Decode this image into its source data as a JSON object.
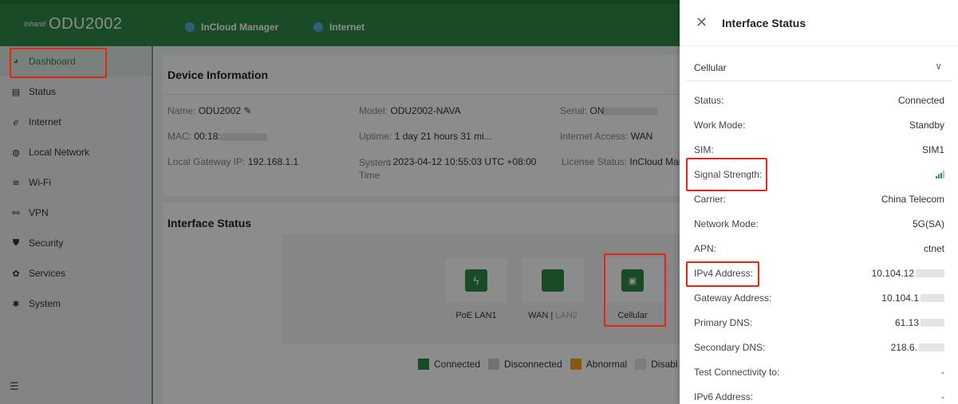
{
  "header": {
    "brand": "inhand",
    "device": "ODU2002",
    "incloud_label": "InCloud Manager",
    "internet_label": "Internet"
  },
  "sidebar": {
    "items": [
      {
        "label": "Dashboard",
        "icon": "dashboard-icon"
      },
      {
        "label": "Status",
        "icon": "status-icon"
      },
      {
        "label": "Internet",
        "icon": "internet-icon"
      },
      {
        "label": "Local Network",
        "icon": "local-network-icon"
      },
      {
        "label": "Wi-Fi",
        "icon": "wifi-icon"
      },
      {
        "label": "VPN",
        "icon": "vpn-icon"
      },
      {
        "label": "Security",
        "icon": "security-icon"
      },
      {
        "label": "Services",
        "icon": "services-icon"
      },
      {
        "label": "System",
        "icon": "system-icon"
      }
    ]
  },
  "device_info": {
    "title": "Device Information",
    "name_label": "Name:",
    "name_value": "ODU2002",
    "model_label": "Model:",
    "model_value": "ODU2002-NAVA",
    "serial_label": "Serial:",
    "serial_value": "ON",
    "mac_label": "MAC:",
    "mac_value": "00:18:",
    "uptime_label": "Uptime:",
    "uptime_value": "1 day 21 hours 31 mi...",
    "internet_access_label": "Internet Access:",
    "internet_access_value": "WAN",
    "gateway_label": "Local Gateway IP:",
    "gateway_value": "192.168.1.1",
    "system_time_label": "System Time",
    "system_time_value": ": 2023-04-12 10:55:03 UTC +08:00",
    "license_label": "License Status:",
    "license_value": "InCloud Man"
  },
  "interface_status": {
    "title": "Interface Status",
    "ports": [
      {
        "label": "PoE LAN1"
      },
      {
        "label": "WAN",
        "sub": "LAN2"
      },
      {
        "label": "Cellular"
      }
    ],
    "legend": {
      "connected": "Connected",
      "disconnected": "Disconnected",
      "abnormal": "Abnormal",
      "disabled": "Disabl"
    }
  },
  "panel": {
    "title": "Interface Status",
    "selected_interface": "Cellular",
    "rows": [
      {
        "key": "Status:",
        "value": "Connected"
      },
      {
        "key": "Work Mode:",
        "value": "Standby"
      },
      {
        "key": "SIM:",
        "value": "SIM1"
      },
      {
        "key": "Signal Strength:",
        "value": ""
      },
      {
        "key": "Carrier:",
        "value": "China Telecom"
      },
      {
        "key": "Network Mode:",
        "value": "5G(SA)"
      },
      {
        "key": "APN:",
        "value": "ctnet"
      },
      {
        "key": "IPv4 Address:",
        "value": "10.104.12"
      },
      {
        "key": "Gateway Address:",
        "value": "10.104.1"
      },
      {
        "key": "Primary DNS:",
        "value": "61.13"
      },
      {
        "key": "Secondary DNS:",
        "value": "218.6."
      },
      {
        "key": "Test Connectivity to:",
        "value": "-"
      },
      {
        "key": "IPv6 Address:",
        "value": "-"
      }
    ]
  },
  "colors": {
    "brand_green": "#2e8b46",
    "highlight_red": "#e2261c",
    "abnormal": "#f0a020",
    "disconnected": "#cfcfcf"
  }
}
